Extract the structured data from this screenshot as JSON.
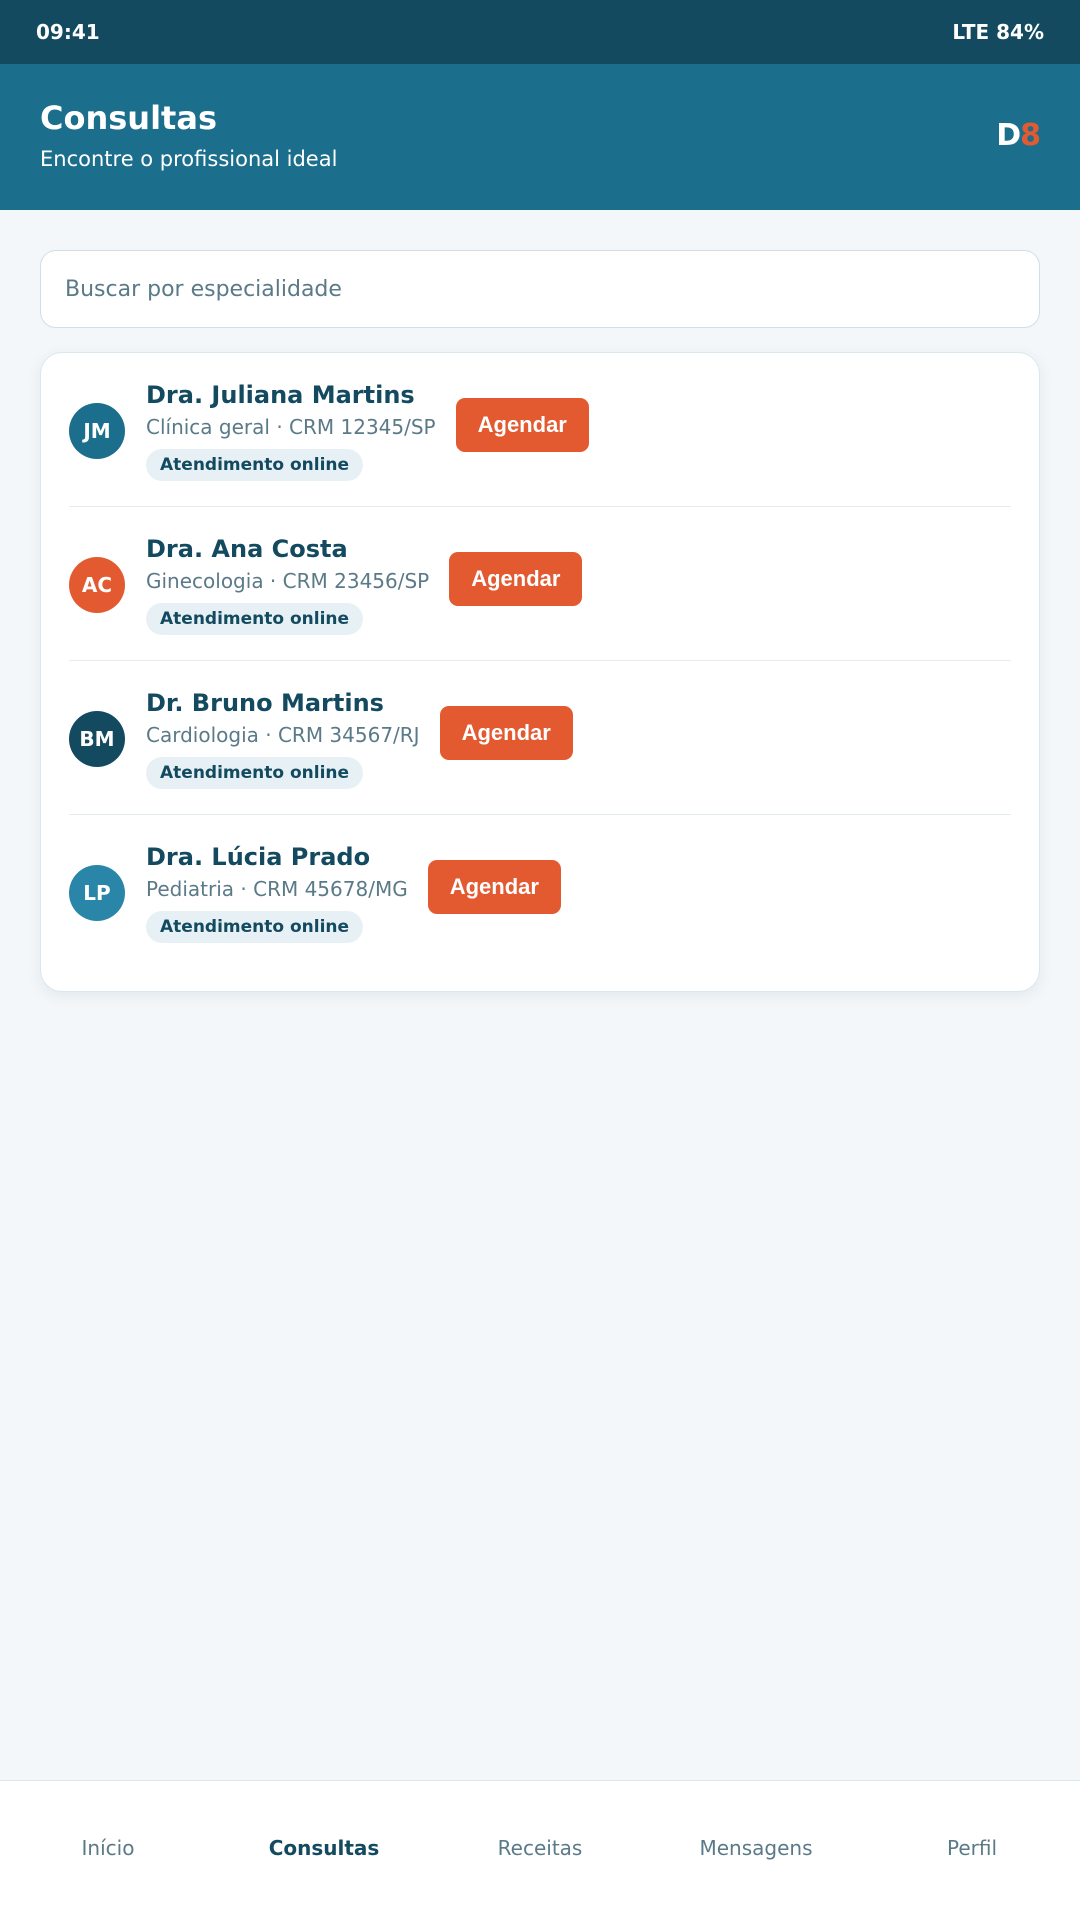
{
  "status_bar": {
    "time": "09:41",
    "signal": "LTE 84%"
  },
  "header": {
    "title": "Consultas",
    "subtitle": "Encontre o profissional ideal",
    "logo": {
      "part1": "D",
      "part2": "8"
    }
  },
  "search": {
    "placeholder": "Buscar por especialidade",
    "value": ""
  },
  "doctors": [
    {
      "initials": "JM",
      "name": "Dra. Juliana Martins",
      "specialty": "Clínica geral · CRM 12345/SP",
      "badge": "Atendimento online",
      "button": "Agendar",
      "avatar_color": "#1b6e8c"
    },
    {
      "initials": "AC",
      "name": "Dra. Ana Costa",
      "specialty": "Ginecologia · CRM 23456/SP",
      "badge": "Atendimento online",
      "button": "Agendar",
      "avatar_color": "#e35a30"
    },
    {
      "initials": "BM",
      "name": "Dr. Bruno Martins",
      "specialty": "Cardiologia · CRM 34567/RJ",
      "badge": "Atendimento online",
      "button": "Agendar",
      "avatar_color": "#134a60"
    },
    {
      "initials": "LP",
      "name": "Dra. Lúcia Prado",
      "specialty": "Pediatria · CRM 45678/MG",
      "badge": "Atendimento online",
      "button": "Agendar",
      "avatar_color": "#2a86a8"
    }
  ],
  "nav": {
    "items": [
      {
        "label": "Início"
      },
      {
        "label": "Consultas"
      },
      {
        "label": "Receitas"
      },
      {
        "label": "Mensagens"
      },
      {
        "label": "Perfil"
      }
    ],
    "active": "Consultas"
  },
  "colors": {
    "primary": "#1b6e8c",
    "primary_dark": "#134a60",
    "accent": "#e35a30",
    "background": "#f3f7fa"
  }
}
